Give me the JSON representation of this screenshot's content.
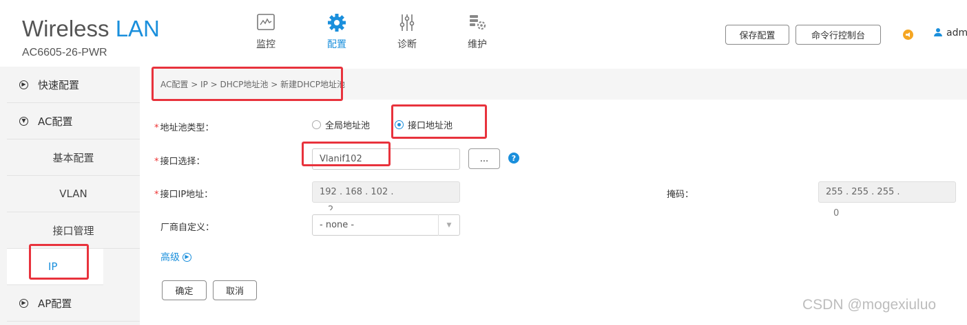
{
  "brand": {
    "title_main": "Wireless ",
    "title_accent": "LAN",
    "model": "AC6605-26-PWR",
    "accent_color": "#1a8fdc"
  },
  "nav": [
    {
      "label": "监控",
      "icon": "monitor-icon",
      "active": false
    },
    {
      "label": "配置",
      "icon": "gear-icon",
      "active": true
    },
    {
      "label": "诊断",
      "icon": "sliders-icon",
      "active": false
    },
    {
      "label": "维护",
      "icon": "maintenance-icon",
      "active": false
    }
  ],
  "header_buttons": {
    "save": "保存配置",
    "cli": "命令行控制台"
  },
  "user": {
    "name": "adm"
  },
  "sidebar": {
    "items": [
      {
        "label": "快速配置",
        "expand": "▶"
      },
      {
        "label": "AC配置",
        "expand": "▼"
      },
      {
        "label": "基本配置"
      },
      {
        "label": "VLAN"
      },
      {
        "label": "接口管理"
      },
      {
        "label": "IP",
        "active": true
      },
      {
        "label": "AP配置",
        "expand": "▶"
      }
    ]
  },
  "breadcrumb": "AC配置 > IP > DHCP地址池 > 新建DHCP地址池",
  "form": {
    "required_mark": "*",
    "pool_type": {
      "label": "地址池类型：",
      "options": [
        "全局地址池",
        "接口地址池"
      ],
      "selected": "接口地址池"
    },
    "interface": {
      "label": "接口选择：",
      "value": "Vlanif102",
      "browse": "...",
      "help": "?"
    },
    "ip": {
      "label": "接口IP地址：",
      "value": "192 . 168 . 102 .",
      "last_octet": "2"
    },
    "mask": {
      "label": "掩码：",
      "value": "255 . 255 . 255 .",
      "last_octet": "0"
    },
    "vendor": {
      "label": "厂商自定义：",
      "value": "- none -",
      "arrow": "▼"
    },
    "advanced": "高级",
    "advanced_icon": "▶",
    "ok": "确定",
    "cancel": "取消"
  },
  "watermark": "CSDN @mogexiuluo",
  "highlight_color": "#e8323c"
}
